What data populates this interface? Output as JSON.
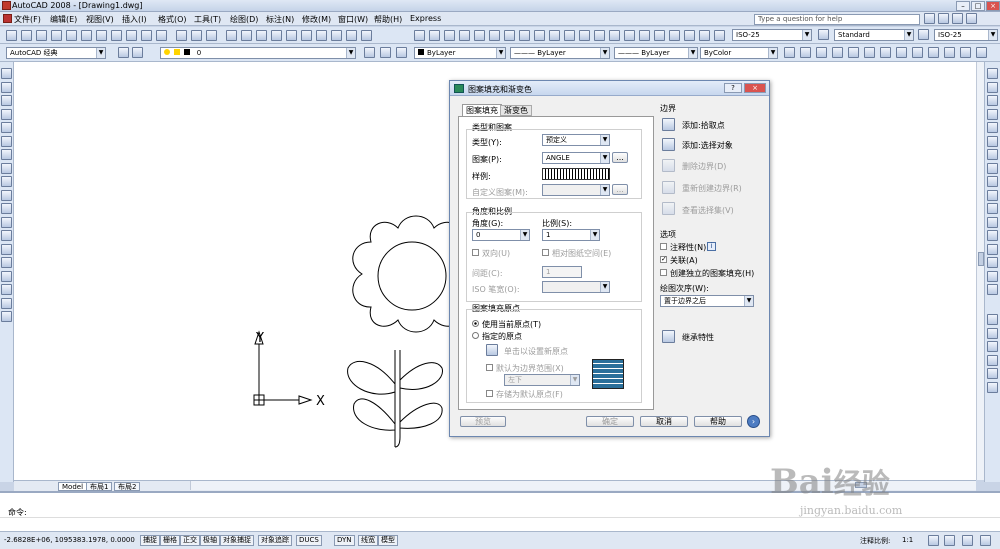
{
  "window": {
    "title": "AutoCAD 2008 - [Drawing1.dwg]"
  },
  "menu": [
    "文件(F)",
    "编辑(E)",
    "视图(V)",
    "插入(I)",
    "格式(O)",
    "工具(T)",
    "绘图(D)",
    "标注(N)",
    "修改(M)",
    "窗口(W)",
    "帮助(H)",
    "Express"
  ],
  "help_placeholder": "Type a question for help",
  "toolbar2": {
    "dimstyle": "ISO-25",
    "textstyle": "Standard",
    "dimstyle2": "ISO-25"
  },
  "toolbar3": {
    "workspace": "AutoCAD 经典",
    "layer": "0",
    "color": "ByLayer",
    "linetype": "ByLayer",
    "lineweight": "ByLayer",
    "plotstyle": "ByColor"
  },
  "ucs": {
    "y_label": "Y",
    "x_label": "X"
  },
  "layout_tabs": [
    "Model",
    "布局1",
    "布局2"
  ],
  "command": {
    "prompt": "命令:"
  },
  "status": {
    "coords": "-2.6828E+06,  1095383.1978, 0.0000",
    "toggles": [
      "捕捉",
      "栅格",
      "正交",
      "极轴",
      "对象捕捉",
      "对象追踪",
      "DUCS",
      "DYN",
      "线宽",
      "模型"
    ],
    "annotation_scale_label": "注释比例:",
    "annotation_scale_value": "1:1"
  },
  "dialog": {
    "title": "图案填充和渐变色",
    "tabs": [
      "图案填充",
      "渐变色"
    ],
    "type_pattern": {
      "group": "类型和图案",
      "type_label": "类型(Y):",
      "type_value": "预定义",
      "pattern_label": "图案(P):",
      "pattern_value": "ANGLE",
      "swatch_label": "样例:",
      "custom_label": "自定义图案(M):"
    },
    "angle_scale": {
      "group": "角度和比例",
      "angle_label": "角度(G):",
      "angle_value": "0",
      "scale_label": "比例(S):",
      "scale_value": "1",
      "double_label": "双向(U)",
      "relative_label": "相对图纸空间(E)",
      "spacing_label": "间距(C):",
      "spacing_value": "1",
      "iso_label": "ISO 笔宽(O):"
    },
    "origin": {
      "group": "图案填充原点",
      "use_current": "使用当前原点(T)",
      "specified": "指定的原点",
      "click_set": "单击以设置新原点",
      "default_extents": "默认为边界范围(X)",
      "position_value": "左下",
      "store_default": "存储为默认原点(F)"
    },
    "boundaries": {
      "group": "边界",
      "add_pick": "添加:拾取点",
      "add_select": "添加:选择对象",
      "remove": "删除边界(D)",
      "recreate": "重新创建边界(R)",
      "view_sel": "查看选择集(V)"
    },
    "options": {
      "group": "选项",
      "annotative": "注释性(N)",
      "associative": "关联(A)",
      "separate": "创建独立的图案填充(H)",
      "draw_order_label": "绘图次序(W):",
      "draw_order_value": "置于边界之后"
    },
    "inherit": "继承特性",
    "buttons": {
      "preview": "预览",
      "ok": "确定",
      "cancel": "取消",
      "help": "帮助"
    }
  },
  "watermark": {
    "brand": "Bai",
    "brand_cn": "经验",
    "url": "jingyan.baidu.com"
  }
}
